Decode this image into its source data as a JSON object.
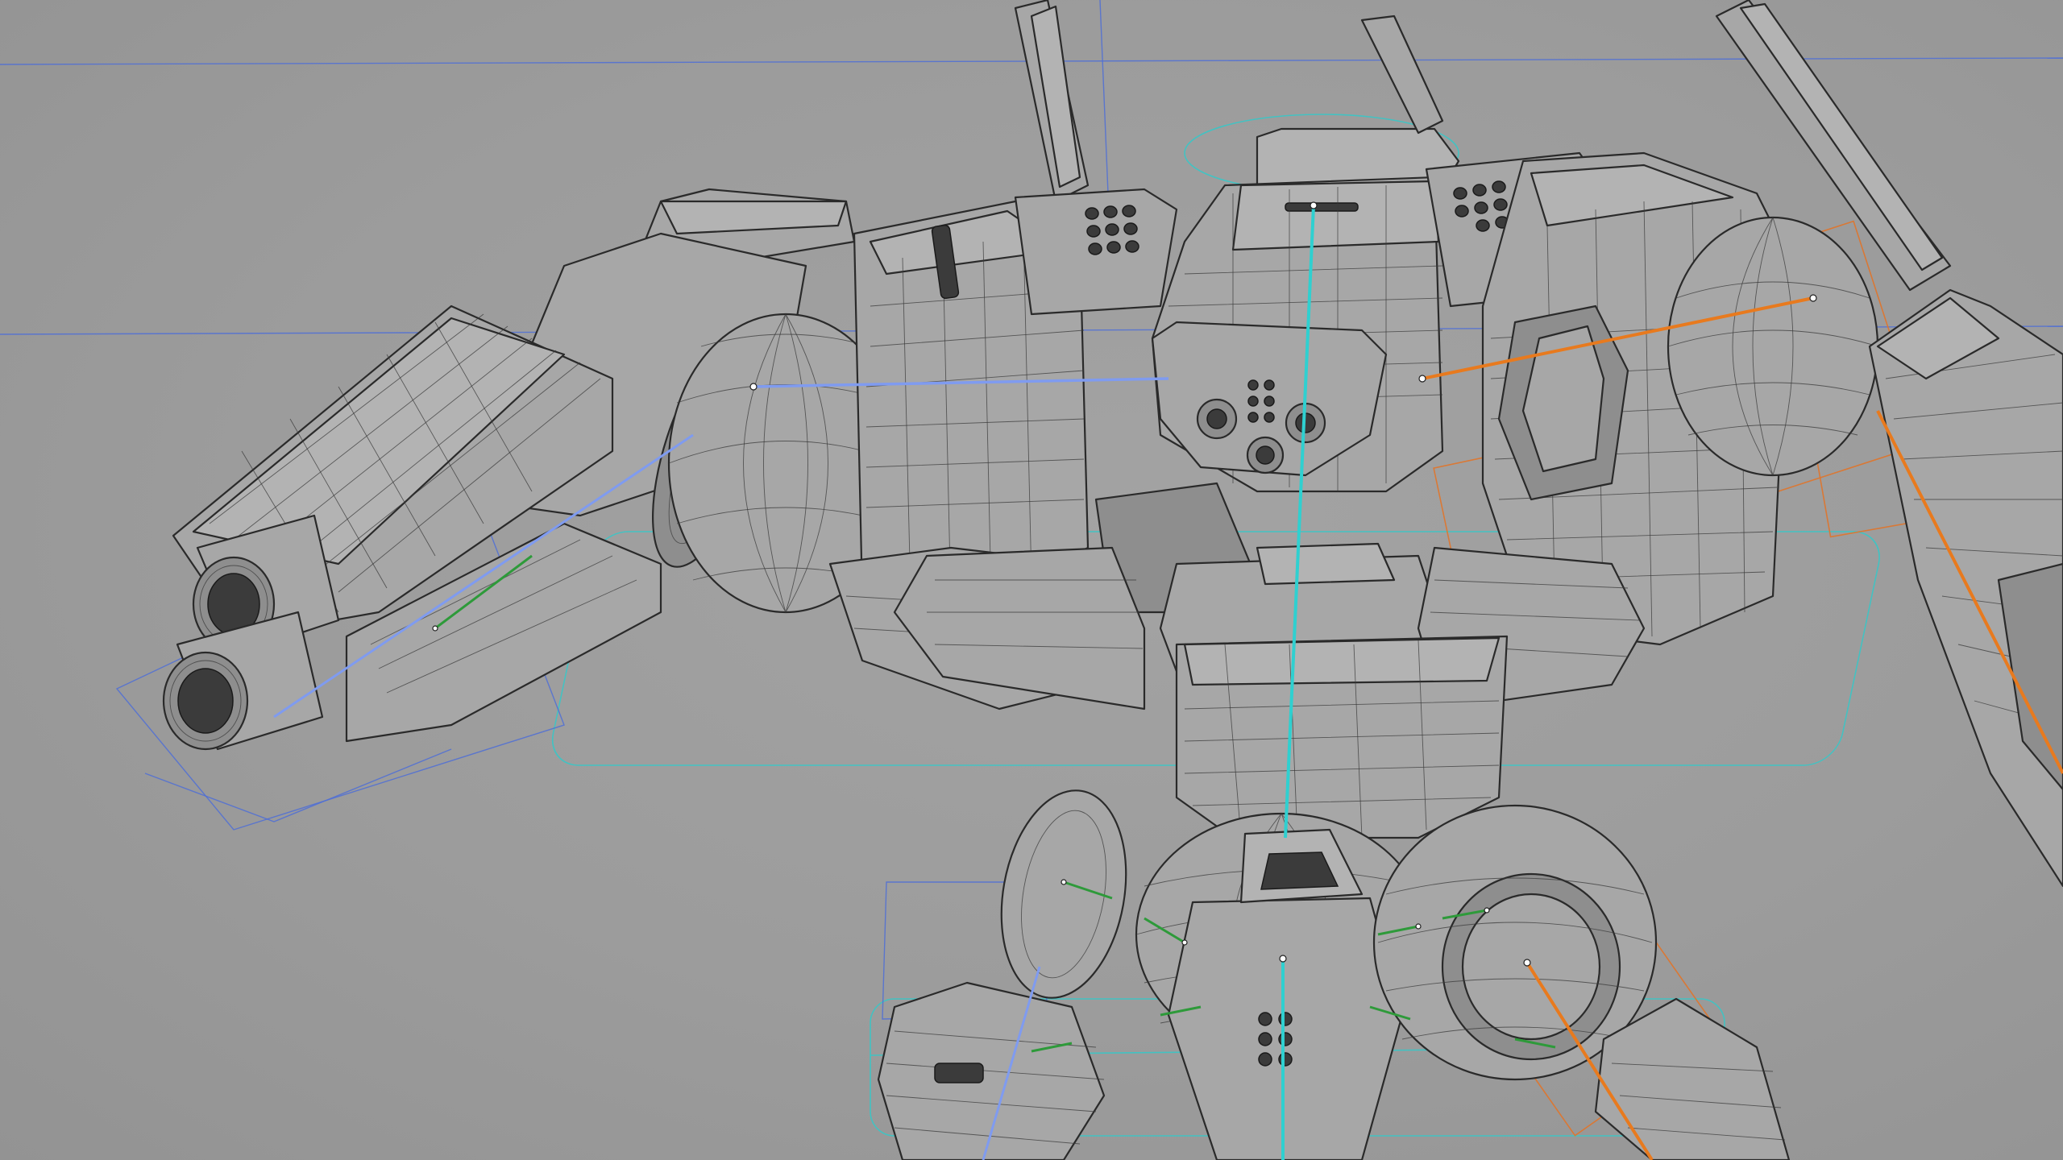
{
  "scene": {
    "subject": "",
    "colors": {
      "background": "#9c9c9c",
      "mesh_fill": "#a7a7a7",
      "mesh_edge": "#2a2a2a",
      "spine_bone": "#2fd0d0",
      "left_arm_bone": "#7f9bf0",
      "right_arm_bone": "#e87a1e",
      "helper_bone": "#2e9a3a",
      "grid_line": "#4f6fd6",
      "control_cyan": "#33c9c9",
      "control_orange": "#e0742a"
    }
  }
}
